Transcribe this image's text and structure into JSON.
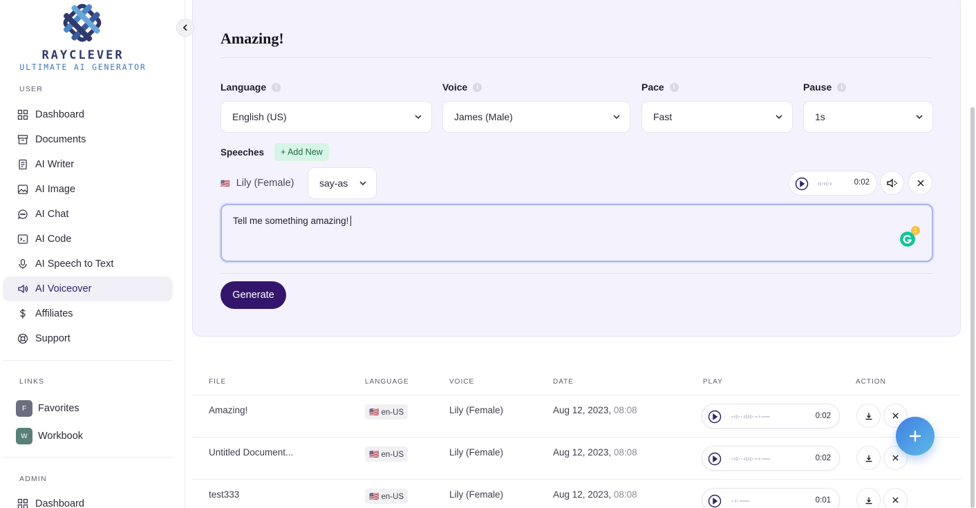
{
  "brand": {
    "name": "RAYCLEVER",
    "tagline": "ULTIMATE AI GENERATOR"
  },
  "sidebar": {
    "user_label": "USER",
    "user_items": [
      {
        "label": "Dashboard",
        "icon": "grid-icon"
      },
      {
        "label": "Documents",
        "icon": "archive-icon"
      },
      {
        "label": "AI Writer",
        "icon": "document-icon"
      },
      {
        "label": "AI Image",
        "icon": "image-icon"
      },
      {
        "label": "AI Chat",
        "icon": "chat-icon"
      },
      {
        "label": "AI Code",
        "icon": "terminal-icon"
      },
      {
        "label": "AI Speech to Text",
        "icon": "microphone-icon"
      },
      {
        "label": "AI Voiceover",
        "icon": "speaker-icon",
        "active": true
      },
      {
        "label": "Affiliates",
        "icon": "dollar-icon"
      },
      {
        "label": "Support",
        "icon": "lifebuoy-icon"
      }
    ],
    "links_label": "LINKS",
    "links": [
      {
        "badge": "F",
        "label": "Favorites",
        "color": "#6b6f80"
      },
      {
        "badge": "W",
        "label": "Workbook",
        "color": "#5a7f78"
      }
    ],
    "admin_label": "ADMIN",
    "admin_items": [
      {
        "label": "Dashboard",
        "icon": "grid-icon"
      }
    ]
  },
  "editor": {
    "title": "Amazing!",
    "language": {
      "label": "Language",
      "value": "English (US)"
    },
    "voice": {
      "label": "Voice",
      "value": "James (Male)"
    },
    "pace": {
      "label": "Pace",
      "value": "Fast"
    },
    "pause": {
      "label": "Pause",
      "value": "1s"
    },
    "speeches_label": "Speeches",
    "add_new": "+ Add New",
    "speech": {
      "flag": "🇺🇸",
      "speaker": "Lily (Female)",
      "say_as": "say-as",
      "duration": "0:02",
      "text": "Tell me something amazing!"
    },
    "grammarly_count": "1",
    "generate": "Generate"
  },
  "table": {
    "headers": {
      "file": "FILE",
      "language": "LANGUAGE",
      "voice": "VOICE",
      "date": "DATE",
      "play": "PLAY",
      "action": "ACTION"
    },
    "rows": [
      {
        "file": "Amazing!",
        "language": "🇺🇸 en-US",
        "voice": "Lily (Female)",
        "date": "Aug 12, 2023,",
        "time": "08:08",
        "duration": "0:02"
      },
      {
        "file": "Untitled Document...",
        "language": "🇺🇸 en-US",
        "voice": "Lily (Female)",
        "date": "Aug 12, 2023,",
        "time": "08:08",
        "duration": "0:02"
      },
      {
        "file": "test333",
        "language": "🇺🇸 en-US",
        "voice": "Lily (Female)",
        "date": "Aug 12, 2023,",
        "time": "08:08",
        "duration": "0:01"
      }
    ]
  },
  "colors": {
    "accent": "#33166b",
    "card_bg": "#f3f2fd",
    "fab": "#3f7fe3"
  }
}
